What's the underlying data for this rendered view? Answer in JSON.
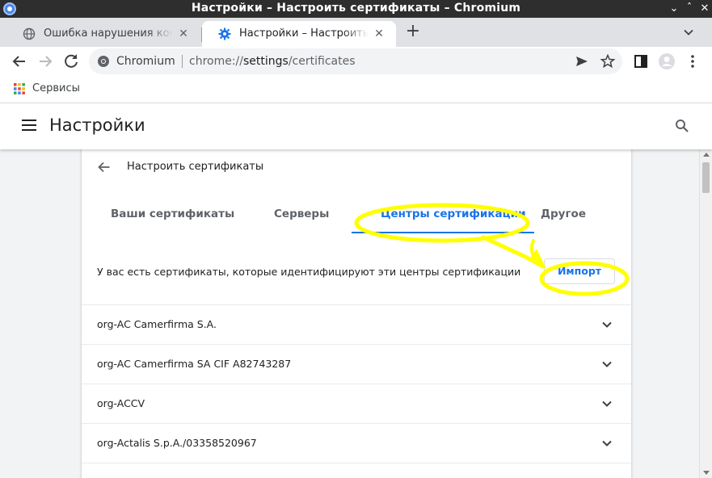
{
  "window": {
    "title": "Настройки – Настроить сертификаты – Chromium",
    "buttons": [
      "⌄",
      "ˆ",
      "✕"
    ]
  },
  "tabs": [
    {
      "title": "Ошибка нарушения конфиденциальности",
      "active": false
    },
    {
      "title": "Настройки – Настроить сертификаты",
      "active": true
    }
  ],
  "toolbar": {
    "site_name": "Chromium",
    "url_scheme": "chrome://",
    "url_host": "settings",
    "url_path": "/certificates"
  },
  "bookmarks": {
    "items": [
      {
        "label": "Сервисы"
      }
    ]
  },
  "settings": {
    "title": "Настройки"
  },
  "subpage": {
    "title": "Настроить сертификаты",
    "tabs": [
      {
        "label": "Ваши сертификаты",
        "selected": false
      },
      {
        "label": "Серверы",
        "selected": false
      },
      {
        "label": "Центры сертификации",
        "selected": true
      },
      {
        "label": "Другое",
        "selected": false
      }
    ],
    "description": "У вас есть сертификаты, которые идентифицируют эти центры сертификации",
    "import_label": "Импорт",
    "certificates": [
      {
        "name": "org-AC Camerfirma S.A."
      },
      {
        "name": "org-AC Camerfirma SA CIF A82743287"
      },
      {
        "name": "org-ACCV"
      },
      {
        "name": "org-Actalis S.p.A./03358520967"
      }
    ]
  },
  "colors": {
    "accent": "#1a73e8",
    "annotation": "#ffff00"
  }
}
